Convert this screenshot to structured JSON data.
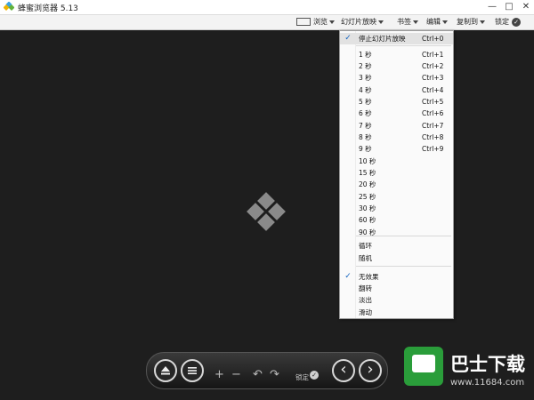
{
  "window": {
    "title": "蜂蜜浏览器 5.13",
    "controls": [
      "—",
      "□",
      "✕"
    ]
  },
  "toolbar": {
    "view_label": "浏览",
    "slideshow_label": "幻灯片放映",
    "bookmarks_label": "书签",
    "edit_label": "编辑",
    "copy_to_label": "复制到",
    "lock_label": "锁定"
  },
  "slideshow_menu": {
    "items": [
      {
        "label": "停止幻灯片放映",
        "shortcut": "Ctrl+0",
        "checked": true
      },
      {
        "label": "1 秒",
        "shortcut": "Ctrl+1"
      },
      {
        "label": "2 秒",
        "shortcut": "Ctrl+2"
      },
      {
        "label": "3 秒",
        "shortcut": "Ctrl+3"
      },
      {
        "label": "4 秒",
        "shortcut": "Ctrl+4"
      },
      {
        "label": "5 秒",
        "shortcut": "Ctrl+5"
      },
      {
        "label": "6 秒",
        "shortcut": "Ctrl+6"
      },
      {
        "label": "7 秒",
        "shortcut": "Ctrl+7"
      },
      {
        "label": "8 秒",
        "shortcut": "Ctrl+8"
      },
      {
        "label": "9 秒",
        "shortcut": "Ctrl+9"
      },
      {
        "label": "10 秒",
        "shortcut": ""
      },
      {
        "label": "15 秒",
        "shortcut": ""
      },
      {
        "label": "20 秒",
        "shortcut": ""
      },
      {
        "label": "25 秒",
        "shortcut": ""
      },
      {
        "label": "30 秒",
        "shortcut": ""
      },
      {
        "label": "60 秒",
        "shortcut": ""
      },
      {
        "label": "90 秒",
        "shortcut": ""
      },
      {
        "label": "循环",
        "shortcut": ""
      },
      {
        "label": "随机",
        "shortcut": ""
      },
      {
        "label": "无效果",
        "shortcut": "",
        "checked": true
      },
      {
        "label": "翻转",
        "shortcut": ""
      },
      {
        "label": "淡出",
        "shortcut": ""
      },
      {
        "label": "滑动",
        "shortcut": ""
      }
    ]
  },
  "controls": {
    "eject_icon": "eject-icon",
    "menu_icon": "menu-icon",
    "zoom_in": "+",
    "zoom_out": "−",
    "rotate_left": "↶",
    "rotate_right": "↷",
    "lock_label": "锁定",
    "lock_check": "✓",
    "prev": "‹",
    "next": "›"
  },
  "watermark": {
    "title": "巴士下载",
    "url": "www.11684.com"
  },
  "colors": {
    "viewer_bg": "#1e1e1e",
    "menu_bg": "#fafafa",
    "check": "#1565c0",
    "watermark_green": "#2a9d3a"
  }
}
